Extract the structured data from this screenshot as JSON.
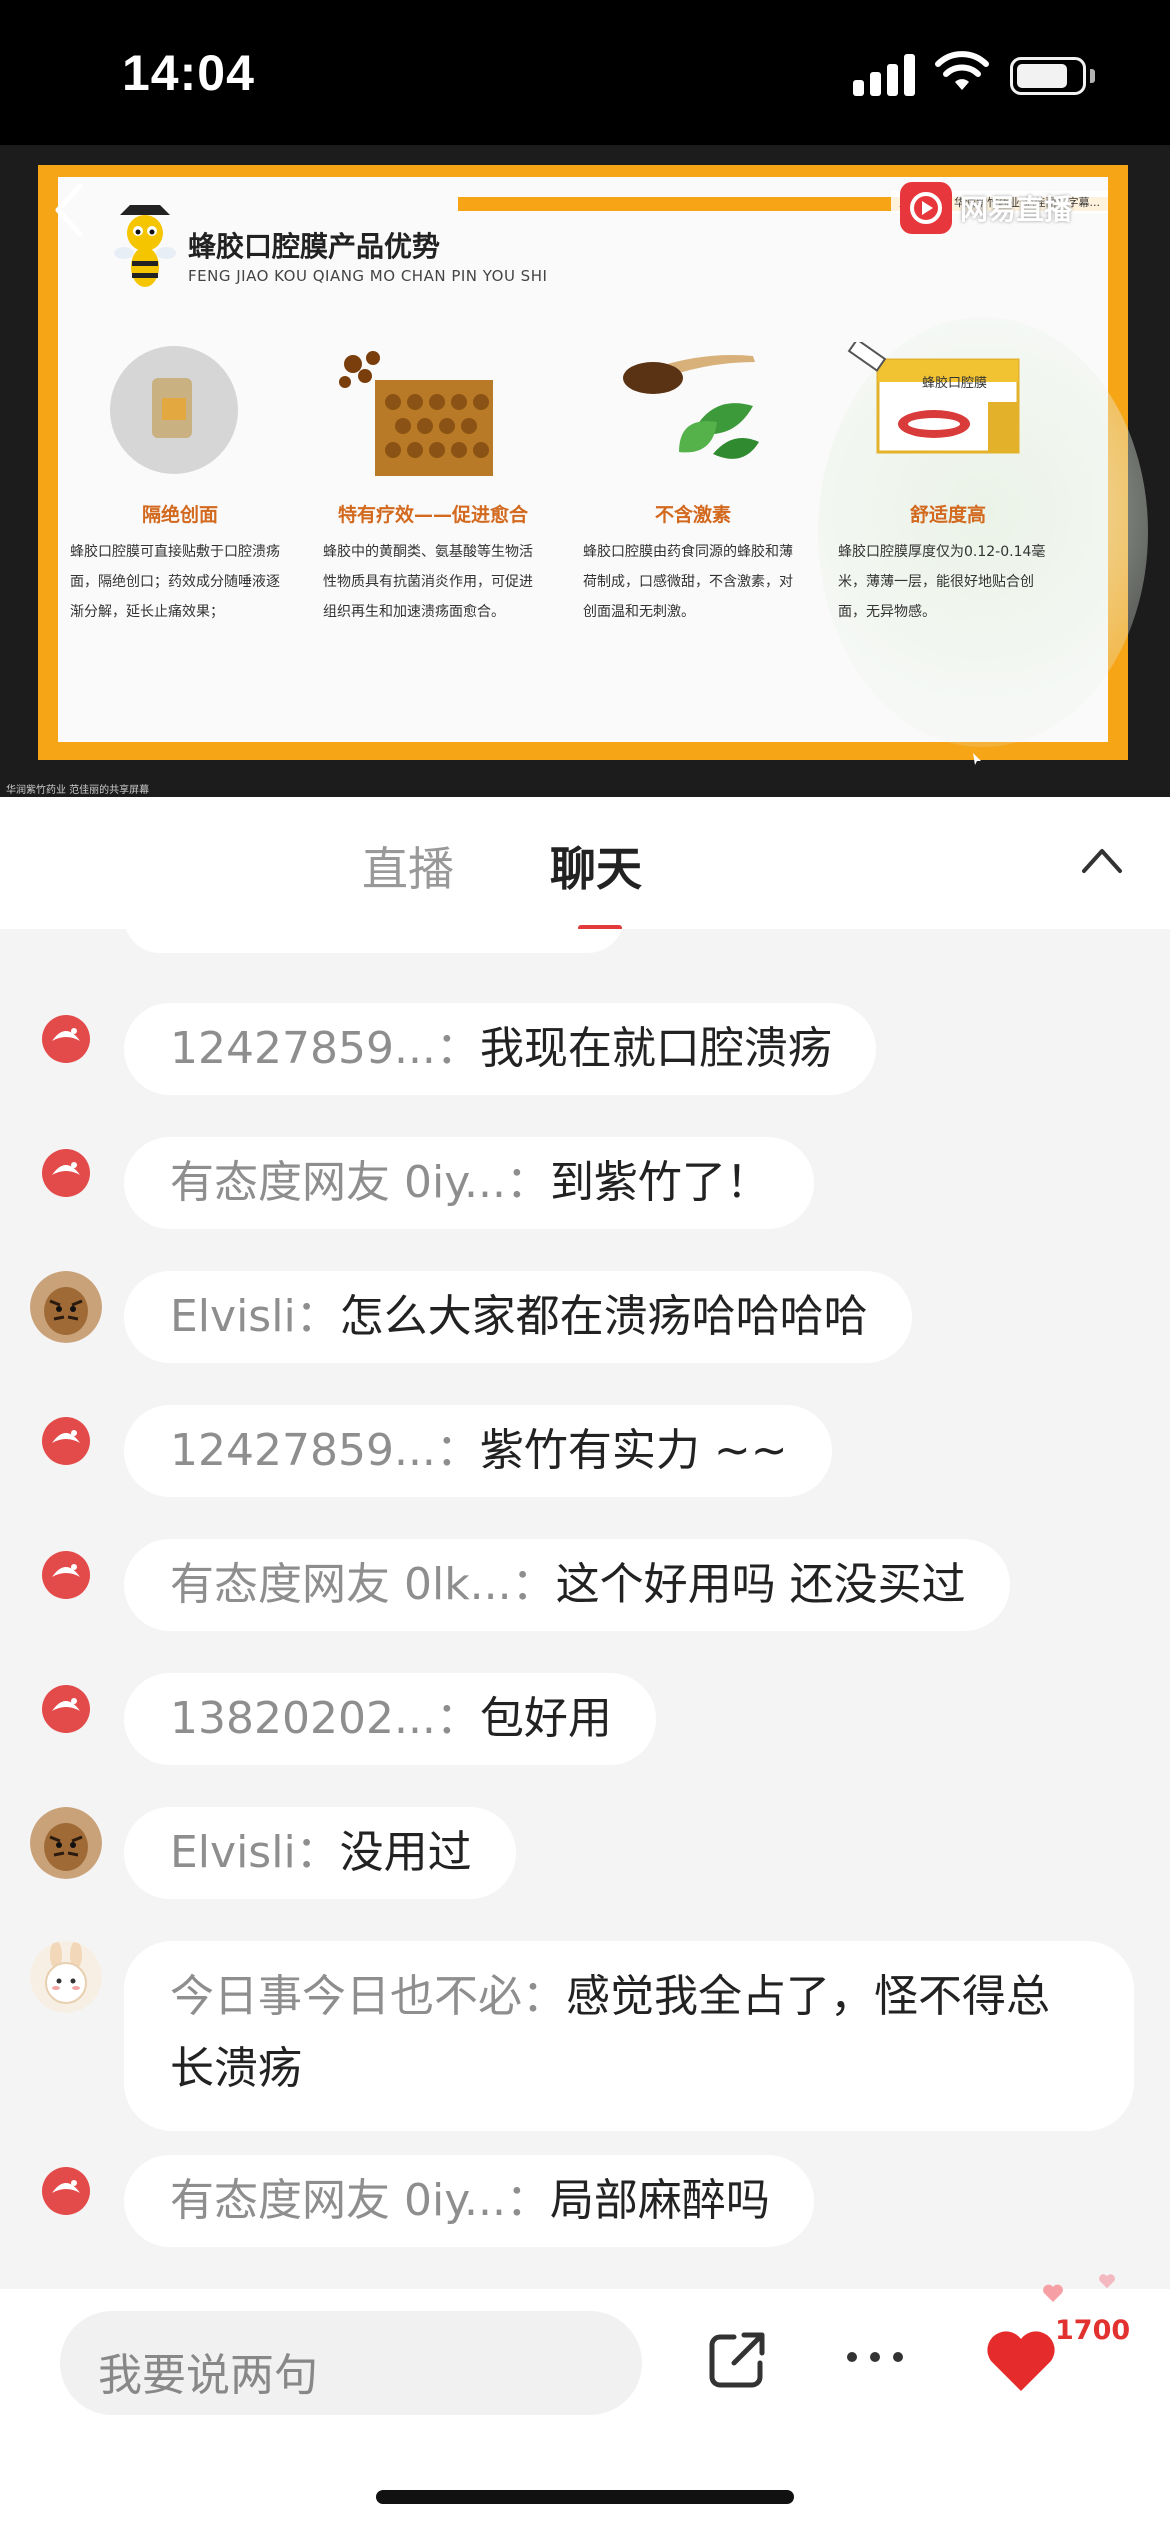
{
  "status_bar": {
    "time": "14:04"
  },
  "video": {
    "brand": "网易直播",
    "top_chip": "正在讲话：华润紫竹药业 范佳丽；字幕...",
    "footer": "华润紫竹药业 范佳丽的共享屏幕",
    "slide": {
      "title": "蜂胶口腔膜产品优势",
      "subtitle": "FENG JIAO KOU QIANG MO CHAN PIN YOU SHI",
      "box_label": "蜂胶口腔膜",
      "features": [
        {
          "title": "隔绝创面",
          "desc": "蜂胶口腔膜可直接贴敷于口腔溃疡面，隔绝创口；药效成分随唾液逐渐分解，延长止痛效果；"
        },
        {
          "title": "特有疗效——促进愈合",
          "desc": "蜂胶中的黄酮类、氨基酸等生物活性物质具有抗菌消炎作用，可促进组织再生和加速溃疡面愈合。"
        },
        {
          "title": "不含激素",
          "desc": "蜂胶口腔膜由药食同源的蜂胶和薄荷制成，口感微甜，不含激素，对创面温和无刺激。"
        },
        {
          "title": "舒适度高",
          "desc": "蜂胶口腔膜厚度仅为0.12-0.14毫米，薄薄一层，能很好地贴合创面，无异物感。"
        }
      ]
    }
  },
  "tabs": {
    "live": "直播",
    "chat": "聊天"
  },
  "chat": {
    "messages": [
      {
        "user": "12427859...：",
        "text": "我现在就口腔溃疡",
        "avatar": "host"
      },
      {
        "user": "有态度网友 0iy...：",
        "text": "到紫竹了！",
        "avatar": "host"
      },
      {
        "user": "Elvisli：",
        "text": "怎么大家都在溃疡哈哈哈哈",
        "avatar": "tiger"
      },
      {
        "user": "12427859...：",
        "text": "紫竹有实力 ~~",
        "avatar": "host"
      },
      {
        "user": "有态度网友 0lk...：",
        "text": "这个好用吗 还没买过",
        "avatar": "host"
      },
      {
        "user": "13820202...：",
        "text": "包好用",
        "avatar": "host"
      },
      {
        "user": "Elvisli：",
        "text": "没用过",
        "avatar": "tiger"
      },
      {
        "user": "今日事今日也不必：",
        "text": "感觉我全占了，怪不得总长溃疡",
        "avatar": "bunny"
      },
      {
        "user": "有态度网友 0iy...：",
        "text": "局部麻醉吗",
        "avatar": "host"
      }
    ]
  },
  "bottom_bar": {
    "input_placeholder": "我要说两句",
    "like_count": "1700"
  },
  "colors": {
    "accent": "#e2322f",
    "slide_orange": "#f6a517"
  },
  "icons": [
    "back-arrow-icon",
    "share-icon",
    "more-icon",
    "heart-icon",
    "chevron-up-icon",
    "signal-icon",
    "wifi-icon",
    "battery-icon"
  ]
}
